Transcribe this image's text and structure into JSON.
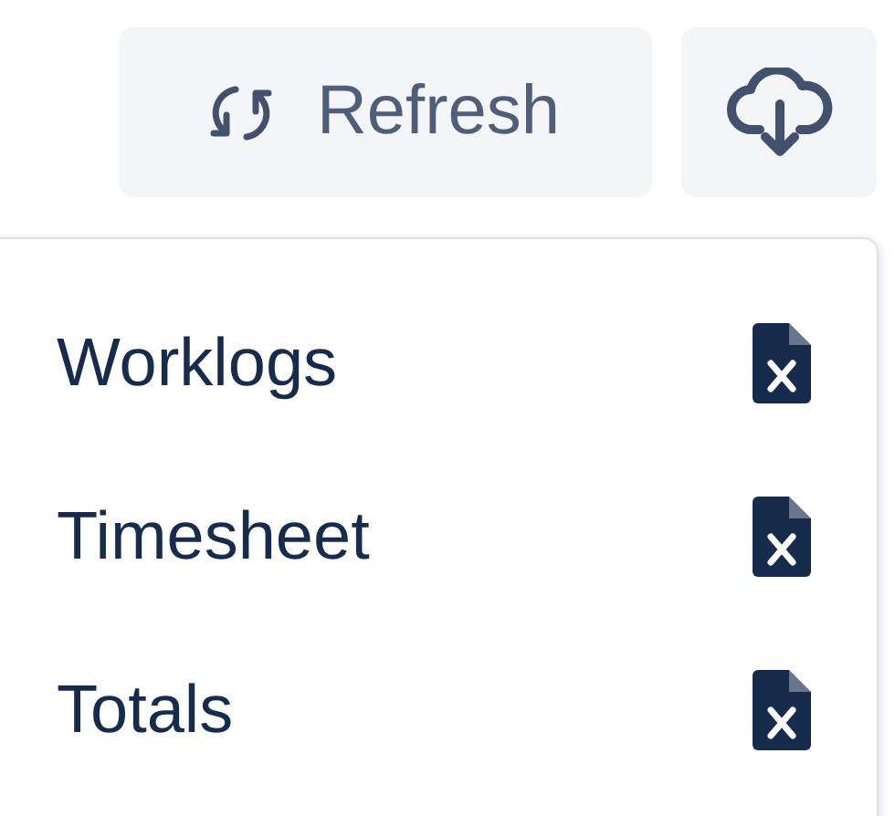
{
  "toolbar": {
    "refresh_button": {
      "label": "Refresh"
    }
  },
  "export_menu": {
    "items": [
      {
        "label": "Worklogs"
      },
      {
        "label": "Timesheet"
      },
      {
        "label": "Totals"
      }
    ]
  }
}
